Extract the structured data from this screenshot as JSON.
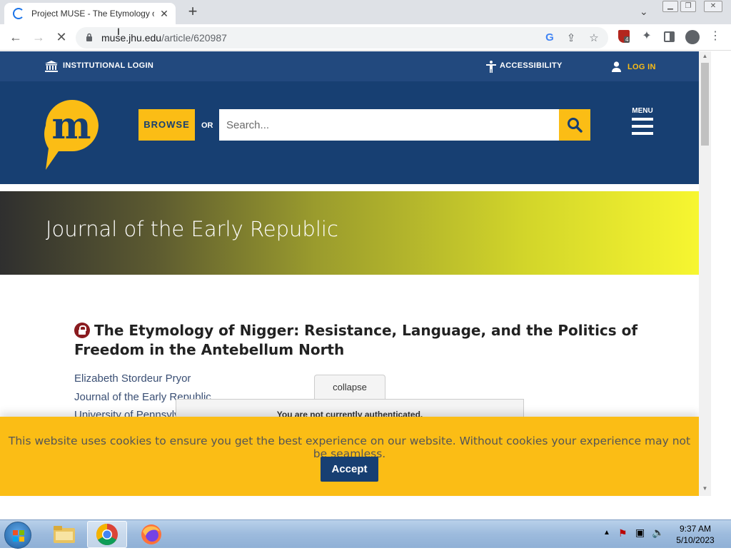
{
  "browser": {
    "tab_title": "Project MUSE - The Etymology of",
    "tab_close": "✕",
    "new_tab": "+",
    "url_host": "muse.jhu.edu",
    "url_path": "/article/620987",
    "extension_badge": "4"
  },
  "site": {
    "institutional_login": "INSTITUTIONAL LOGIN",
    "accessibility": "ACCESSIBILITY",
    "log_in": "LOG IN",
    "browse": "BROWSE",
    "or": "OR",
    "search_placeholder": "Search...",
    "menu_label": "MENU",
    "accent_color": "#fbbd15",
    "brand_color": "#173f72"
  },
  "journal": {
    "title": "Journal of the Early Republic"
  },
  "article": {
    "title": "The Etymology of Nigger: Resistance, Language, and the Politics of Freedom in the Antebellum North",
    "author": "Elizabeth Stordeur Pryor",
    "journal": "Journal of the Early Republic",
    "publisher": "University of Pennsylvania Press"
  },
  "auth_notice": {
    "collapse_label": "collapse",
    "message": "You are not currently authenticated."
  },
  "cookie_banner": {
    "message": "This website uses cookies to ensure you get the best experience on our website. Without cookies your experience may not be seamless.",
    "accept_label": "Accept"
  },
  "taskbar": {
    "time": "9:37 AM",
    "date": "5/10/2023"
  }
}
